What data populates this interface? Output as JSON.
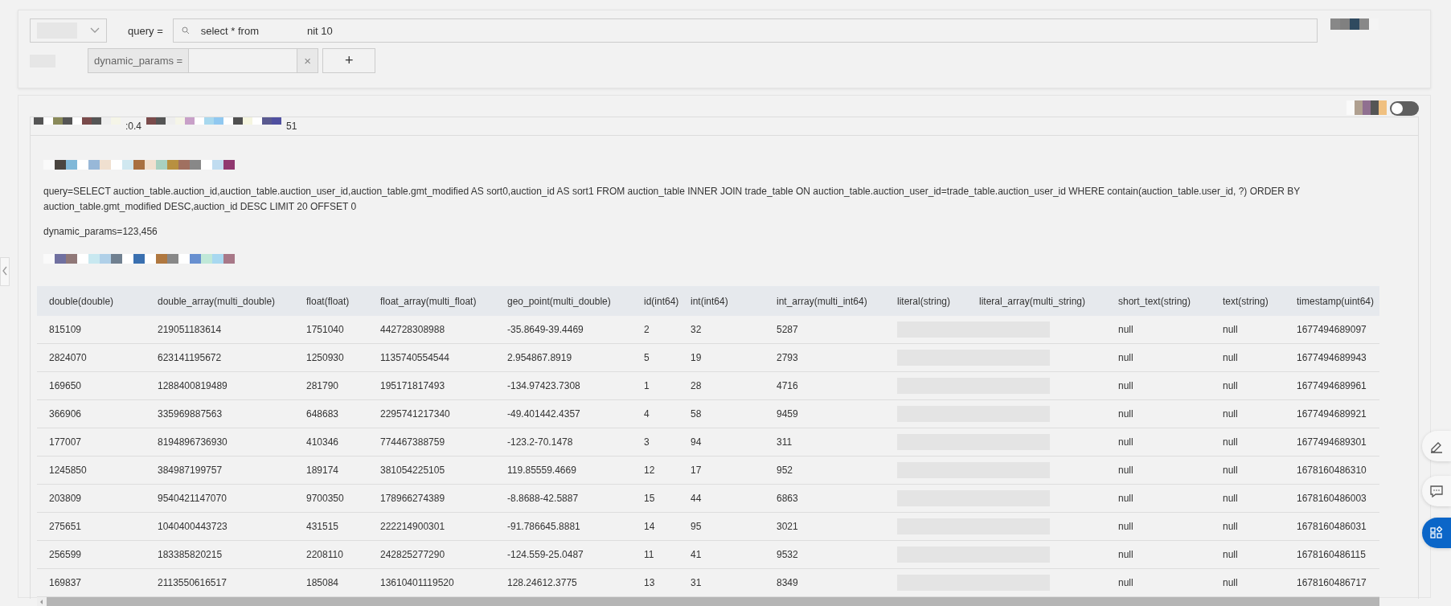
{
  "query_bar": {
    "label": "query =",
    "value_start": "select * from",
    "value_end": "nit 10"
  },
  "params_row": {
    "label": "dynamic_params =",
    "clear": "×",
    "add": "+"
  },
  "result": {
    "toggle": {
      "on": false
    },
    "stat_a": ":0.4",
    "stat_b": "51",
    "query_text": "query=SELECT auction_table.auction_id,auction_table.auction_user_id,auction_table.gmt_modified AS sort0,auction_id AS sort1 FROM auction_table INNER JOIN trade_table ON auction_table.auction_user_id=trade_table.auction_user_id WHERE contain(auction_table.user_id, ?) ORDER BY auction_table.gmt_modified DESC,auction_id DESC LIMIT 20 OFFSET 0",
    "params_text": "dynamic_params=123,456"
  },
  "table": {
    "columns": [
      "double(double)",
      "double_array(multi_double)",
      "float(float)",
      "float_array(multi_float)",
      "geo_point(multi_double)",
      "id(int64)",
      "int(int64)",
      "int_array(multi_int64)",
      "literal(string)",
      "literal_array(multi_string)",
      "short_text(string)",
      "text(string)",
      "timestamp(uint64)"
    ],
    "rows": [
      {
        "cells": [
          "815109",
          "219051183614",
          "1751040",
          "442728308988",
          "-35.8649-39.4469",
          "2",
          "32",
          "5287"
        ],
        "tail": [
          "null",
          "null",
          "1677494689097"
        ]
      },
      {
        "cells": [
          "2824070",
          "623141195672",
          "1250930",
          "1135740554544",
          "2.954867.8919",
          "5",
          "19",
          "2793"
        ],
        "tail": [
          "null",
          "null",
          "1677494689943"
        ]
      },
      {
        "cells": [
          "169650",
          "1288400819489",
          "281790",
          "195171817493",
          "-134.97423.7308",
          "1",
          "28",
          "4716"
        ],
        "tail": [
          "null",
          "null",
          "1677494689961"
        ]
      },
      {
        "cells": [
          "366906",
          "335969887563",
          "648683",
          "2295741217340",
          "-49.401442.4357",
          "4",
          "58",
          "9459"
        ],
        "tail": [
          "null",
          "null",
          "1677494689921"
        ]
      },
      {
        "cells": [
          "177007",
          "8194896736930",
          "410346",
          "774467388759",
          "-123.2-70.1478",
          "3",
          "94",
          "311"
        ],
        "tail": [
          "null",
          "null",
          "1677494689301"
        ]
      },
      {
        "cells": [
          "1245850",
          "384987199757",
          "189174",
          "381054225105",
          "119.85559.4669",
          "12",
          "17",
          "952"
        ],
        "tail": [
          "null",
          "null",
          "1678160486310"
        ]
      },
      {
        "cells": [
          "203809",
          "9540421147070",
          "9700350",
          "178966274389",
          "-8.8688-42.5887",
          "15",
          "44",
          "6863"
        ],
        "tail": [
          "null",
          "null",
          "1678160486003"
        ]
      },
      {
        "cells": [
          "275651",
          "1040400443723",
          "431515",
          "222214900301",
          "-91.786645.8881",
          "14",
          "95",
          "3021"
        ],
        "tail": [
          "null",
          "null",
          "1678160486031"
        ]
      },
      {
        "cells": [
          "256599",
          "183385820215",
          "2208110",
          "242825277290",
          "-124.559-25.0487",
          "11",
          "41",
          "9532"
        ],
        "tail": [
          "null",
          "null",
          "1678160486115"
        ]
      },
      {
        "cells": [
          "169837",
          "2113550616517",
          "185084",
          "13610401119520",
          "128.24612.3775",
          "13",
          "31",
          "8349"
        ],
        "tail": [
          "null",
          "null",
          "1678160486717"
        ]
      }
    ]
  }
}
